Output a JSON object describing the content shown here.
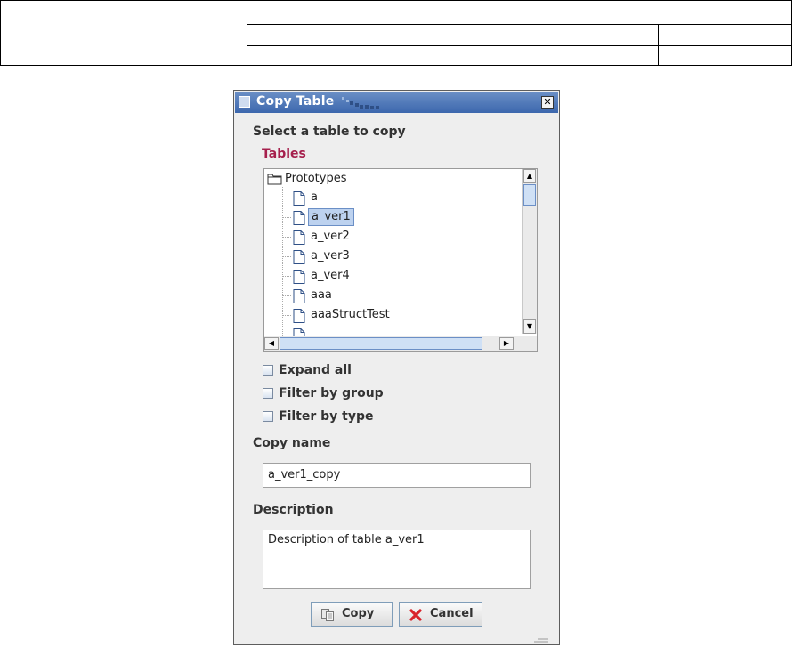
{
  "dialog": {
    "title": "Copy Table",
    "prompt": "Select a table to copy",
    "tables_label": "Tables",
    "tree": {
      "root": "Prototypes",
      "items": [
        "a",
        "a_ver1",
        "a_ver2",
        "a_ver3",
        "a_ver4",
        "aaa",
        "aaaStructTest"
      ],
      "selected": "a_ver1"
    },
    "options": {
      "expand_all": "Expand all",
      "filter_group": "Filter by group",
      "filter_type": "Filter by type"
    },
    "copy_name_label": "Copy name",
    "copy_name_value": "a_ver1_copy",
    "description_label": "Description",
    "description_value": "Description of table a_ver1",
    "copy_button": "Copy",
    "cancel_button": "Cancel"
  },
  "icons": {
    "window": "window-icon",
    "close": "close-icon",
    "folder": "folder-icon",
    "file": "file-icon",
    "copy": "copy-icon",
    "cancel": "cancel-x-icon"
  },
  "colors": {
    "title_bar": "#3c67ae",
    "tables_label": "#a6204d",
    "selection": "#bdd2ef",
    "cancel_icon": "#d9232a"
  }
}
